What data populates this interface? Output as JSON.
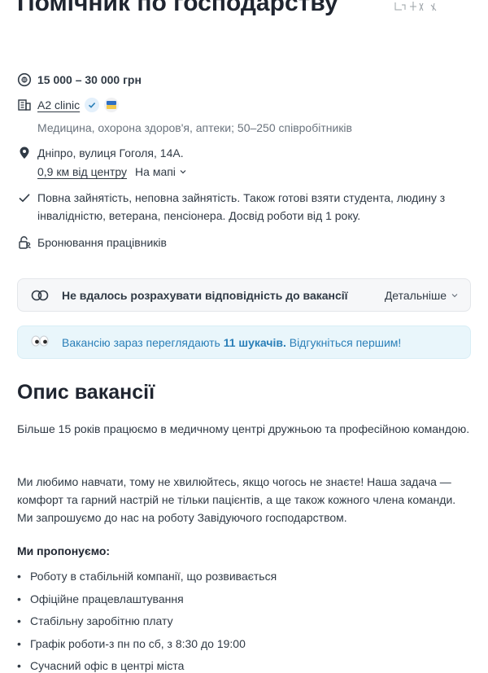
{
  "job": {
    "title": "Помічник по господарству",
    "salary": "15 000 – 30 000 грн",
    "company": "A2 clinic",
    "company_sub": "Медицина, охорона здоров'я, аптеки; 50–250 співробітників",
    "address": "Дніпро, вулиця Гоголя, 14А.",
    "distance": "0,9 км від центру",
    "map_label": "На мапі",
    "employment": "Повна зайнятість, неповна зайнятість. Також готові взяти студента, людину з інвалідністю, ветерана, пенсіонера. Досвід роботи від 1 року.",
    "reservation": "Бронювання працівників"
  },
  "match": {
    "text": "Не вдалось розрахувати відповідність до вакансії",
    "more_label": "Детальніше"
  },
  "viewers": {
    "prefix": "Вакансію зараз переглядають ",
    "count_text": "11 шукачів.",
    "suffix": " Відгукніться першим!"
  },
  "description": {
    "heading": "Опис вакансії",
    "paragraph1": "Більше 15 років працюємо в медичному центрі дружньою та професійною командою.",
    "paragraph2": "Ми любимо навчати, тому не хвилюйтесь, якщо чогось не знаєте! Наша задача — комфорт та гарний настрій не тільки пацієнтів, а ще також кожного члена команди. Ми запрошуємо до нас на роботу Завідуючого господарством.",
    "offers_heading": "Ми пропонуємо:",
    "offers": [
      "Роботу в стабільній компанії, що розвивається",
      "Офіційне працевлаштування",
      "Стабільну заробітню плату",
      "Графік роботи-з пн по сб, з 8:30 до 19:00",
      "Сучасний офіс в центрі міста"
    ]
  },
  "colors": {
    "text": "#303a45",
    "muted": "#6a737d",
    "info_blue": "#2a7fb8",
    "info_bg": "#e9f6fb"
  }
}
